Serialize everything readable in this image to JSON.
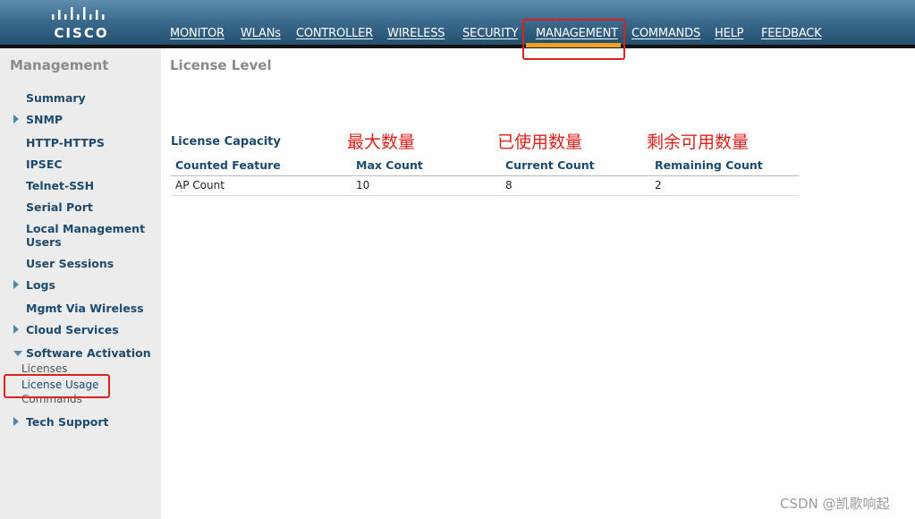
{
  "brand": {
    "logo_text": "CISCO",
    "logo_icon": "cisco-bridge-logo"
  },
  "nav": {
    "items": [
      {
        "label": "MONITOR"
      },
      {
        "label": "WLANs"
      },
      {
        "label": "CONTROLLER"
      },
      {
        "label": "WIRELESS"
      },
      {
        "label": "SECURITY"
      },
      {
        "label": "MANAGEMENT",
        "active": true
      },
      {
        "label": "COMMANDS"
      },
      {
        "label": "HELP"
      },
      {
        "label": "FEEDBACK"
      }
    ]
  },
  "sidebar": {
    "title": "Management",
    "items": [
      {
        "label": "Summary"
      },
      {
        "label": "SNMP",
        "expandable": true
      },
      {
        "label": "HTTP-HTTPS"
      },
      {
        "label": "IPSEC"
      },
      {
        "label": "Telnet-SSH"
      },
      {
        "label": "Serial Port"
      },
      {
        "label": "Local Management Users"
      },
      {
        "label": "User Sessions"
      },
      {
        "label": "Logs",
        "expandable": true
      },
      {
        "label": "Mgmt Via Wireless"
      },
      {
        "label": "Cloud Services",
        "expandable": true
      },
      {
        "label": "Software Activation",
        "expanded": true
      },
      {
        "label": "Tech Support",
        "expandable": true
      }
    ],
    "sub_items": [
      {
        "label": "Licenses"
      },
      {
        "label": "License Usage",
        "active": true
      },
      {
        "label": "Commands"
      }
    ]
  },
  "main": {
    "title": "License Level",
    "section_title": "License Capacity",
    "annotations": [
      "最大数量",
      "已使用数量",
      "剩余可用数量"
    ],
    "table": {
      "headers": [
        "Counted Feature",
        "Max Count",
        "Current Count",
        "Remaining Count"
      ],
      "rows": [
        [
          "AP Count",
          "10",
          "8",
          "2"
        ]
      ]
    }
  },
  "watermark": "CSDN @凯歌响起",
  "colors": {
    "header_top": "#5f8eb0",
    "header_bottom": "#24506f",
    "active_tab": "#f0a11e",
    "link_blue": "#1c4a6e",
    "highlight_red": "#e0201b",
    "sidebar_bg": "#ececec"
  }
}
